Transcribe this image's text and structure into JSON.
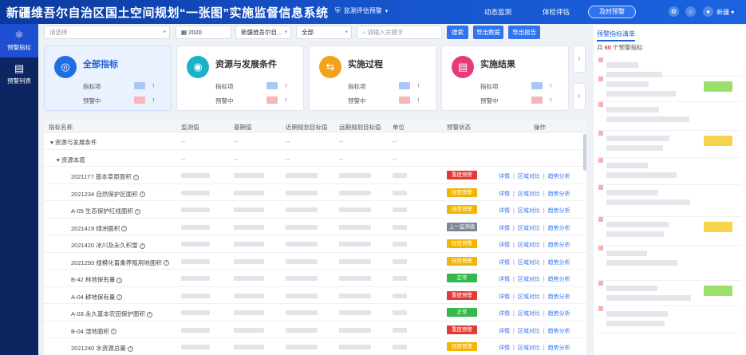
{
  "header": {
    "title": "新疆维吾尔自治区国土空间规划“一张图”实施监督信息系统",
    "module_select": "监测评估预警",
    "nav": [
      "动态监测",
      "体检评估"
    ],
    "warn_button": "及时预警",
    "user_name": "新疆"
  },
  "sidebar": {
    "items": [
      {
        "label": "预警指标",
        "icon": "target-icon",
        "active": true
      },
      {
        "label": "预警列表",
        "icon": "document-icon",
        "active": false
      }
    ]
  },
  "filters": {
    "select1_placeholder": "请选择",
    "year": "2020",
    "region": "新疆维吾尔自...",
    "scope": "全部",
    "keyword_placeholder": "请输入关键字",
    "search_label": "搜索",
    "export_data_label": "导出数据",
    "export_report_label": "导出报告"
  },
  "cards": [
    {
      "title": "全部指标",
      "row1": "指标项",
      "row2": "预警中",
      "color": "#1f6fe0",
      "icon": "target-icon"
    },
    {
      "title": "资源与发展条件",
      "row1": "指标项",
      "row2": "预警中",
      "color": "#19b3c8",
      "icon": "resource-icon"
    },
    {
      "title": "实施过程",
      "row1": "指标项",
      "row2": "预警中",
      "color": "#f2a21b",
      "icon": "process-icon"
    },
    {
      "title": "实施结果",
      "row1": "指标项",
      "row2": "预警中",
      "color": "#e63b7a",
      "icon": "result-icon"
    }
  ],
  "table": {
    "headers": [
      "指标名称",
      "监测值",
      "基期值",
      "近期规划目标值",
      "远期规划目标值",
      "单位",
      "预警状态",
      "操作"
    ],
    "group1": "资源与发展条件",
    "group2": "资源本底",
    "rows": [
      {
        "name": "2021177 基本草原面积",
        "status": "重度预警",
        "color": "#e53935"
      },
      {
        "name": "2021234 自然保护区面积",
        "status": "轻度预警",
        "color": "#f4b400"
      },
      {
        "name": "A-05 生态保护红线面积",
        "status": "轻度预警",
        "color": "#f4b400"
      },
      {
        "name": "2021419 绿洲面积",
        "status": "上一监测值为",
        "color": "#7d8796"
      },
      {
        "name": "2021420 冰川及永久积雪",
        "status": "轻度预警",
        "color": "#f4b400"
      },
      {
        "name": "2021293 规模化畜禽养殖用地面积",
        "status": "轻度预警",
        "color": "#f4b400"
      },
      {
        "name": "B-42 林地保有量",
        "status": "正常",
        "color": "#34b84b"
      },
      {
        "name": "A-04 耕地保有量",
        "status": "重度预警",
        "color": "#e53935"
      },
      {
        "name": "A-03 永久基本农田保护面积",
        "status": "正常",
        "color": "#34b84b"
      },
      {
        "name": "B-04 湿地面积",
        "status": "重度预警",
        "color": "#e53935"
      },
      {
        "name": "2021240 水资源总量",
        "status": "轻度预警",
        "color": "#f4b400"
      }
    ],
    "ops": [
      "详情",
      "区域对比",
      "趋势分析"
    ],
    "dash": "--"
  },
  "right_panel": {
    "title": "预警指标清单",
    "count_prefix": "共",
    "count": "60",
    "count_suffix": "个预警指标",
    "chip_colors": [
      "",
      "#9be06a",
      "",
      "#f7d24c",
      "",
      "",
      "#f7d24c",
      "",
      "#9be06a",
      ""
    ]
  }
}
